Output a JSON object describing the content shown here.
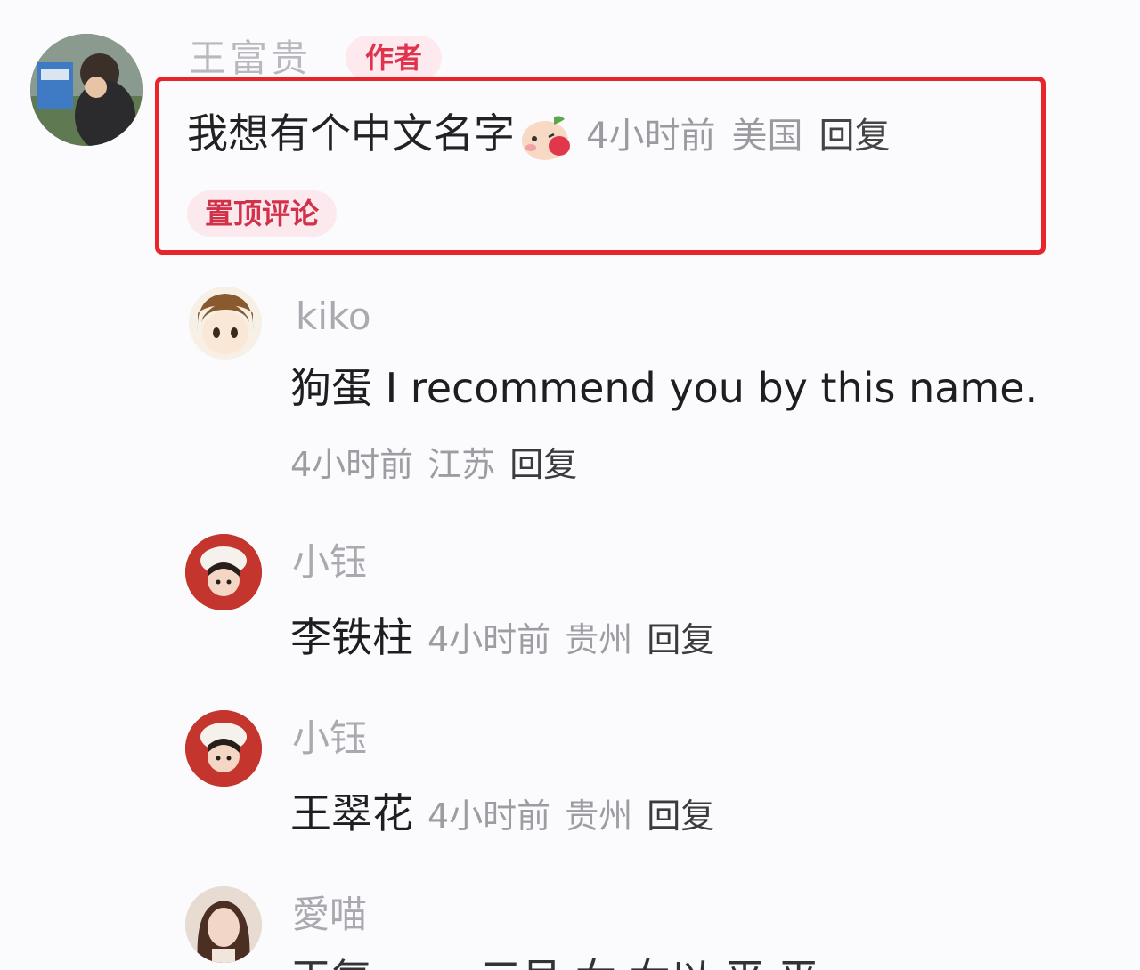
{
  "main_comment": {
    "author": "王富贵",
    "author_tag": "作者",
    "text": "我想有个中文名字",
    "emoji": "blushing-peach-emoji",
    "time": "4小时前",
    "location": "美国",
    "reply_label": "回复",
    "pinned_label": "置顶评论",
    "highlight_color": "#e8252b"
  },
  "replies": [
    {
      "name": "kiko",
      "text": "狗蛋  I recommend you by this name.",
      "time": "4小时前",
      "location": "江苏",
      "reply_label": "回复"
    },
    {
      "name": "小钰",
      "text": "李铁柱",
      "time": "4小时前",
      "location": "贵州",
      "reply_label": "回复"
    },
    {
      "name": "小钰",
      "text": "王翠花",
      "time": "4小时前",
      "location": "贵州",
      "reply_label": "回复"
    },
    {
      "name": "愛喵",
      "text": "王复 …… 三号 女 女以 平 平",
      "time": "",
      "location": "",
      "reply_label": ""
    }
  ],
  "colors": {
    "author_tag_text": "#e0334d",
    "author_tag_bg": "#fde9ee",
    "pinned_text": "#d2314a",
    "pinned_bg": "#fbe9ee"
  }
}
